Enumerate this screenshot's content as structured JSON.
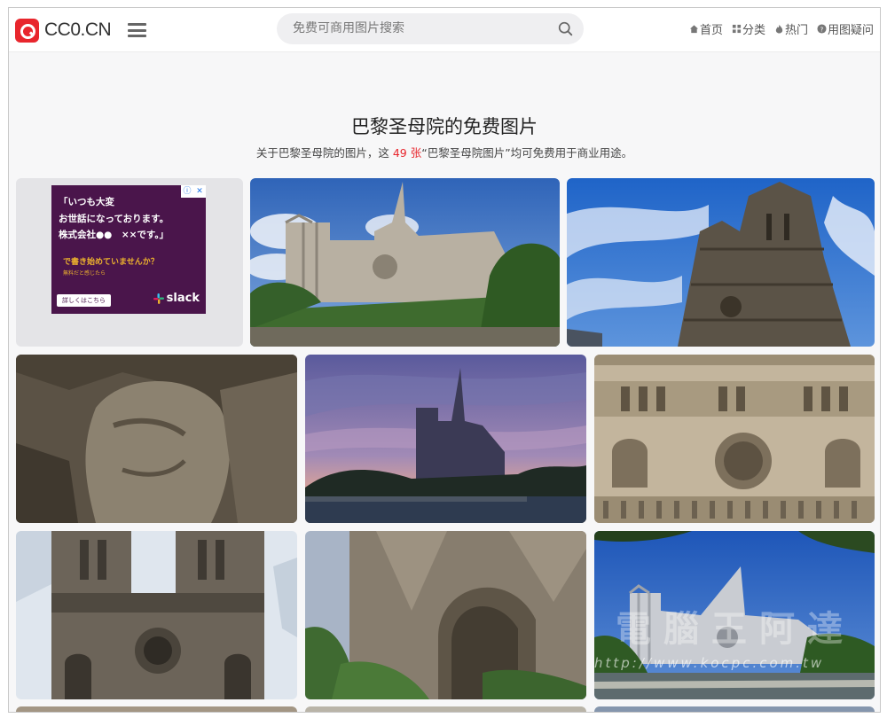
{
  "header": {
    "logo_text": "CC0.CN",
    "search_placeholder": "免费可商用图片搜索",
    "nav": [
      {
        "label": "首页",
        "icon": "home-icon"
      },
      {
        "label": "分类",
        "icon": "grid-icon"
      },
      {
        "label": "热门",
        "icon": "flame-icon"
      },
      {
        "label": "用图疑问",
        "icon": "question-icon"
      }
    ]
  },
  "heading": {
    "title": "巴黎圣母院的免费图片",
    "subtitle_prefix": "关于巴黎圣母院的图片，这",
    "count": "49 张",
    "subtitle_suffix": "“巴黎圣母院图片”均可免费用于商业用途。"
  },
  "ad": {
    "line1": "「いつも大変",
    "line2": "お世話になっております。",
    "line3": "株式会社●●　××です。」",
    "cta": "で書き始めていませんか？",
    "small": "無料だと感じたら",
    "button": "詳しくはこちら",
    "brand": "slack",
    "badge_info": "ⓘ",
    "badge_close": "✕"
  },
  "images": [
    {
      "subject": "Notre-Dame side view with blue sky"
    },
    {
      "subject": "Notre-Dame towers from below"
    },
    {
      "subject": "Stone gargoyle face"
    },
    {
      "subject": "Notre-Dame at dusk over the Seine"
    },
    {
      "subject": "Notre-Dame west facade rose window"
    },
    {
      "subject": "Notre-Dame facade with clouds"
    },
    {
      "subject": "Gothic portal detail"
    },
    {
      "subject": "Notre-Dame from the river with trees"
    }
  ],
  "watermark": {
    "big": "電腦王阿達",
    "url": "http://www.kocpc.com.tw"
  },
  "colors": {
    "accent": "#e8262d",
    "ad_bg": "#4a154b",
    "ad_yellow": "#ecb22e"
  }
}
